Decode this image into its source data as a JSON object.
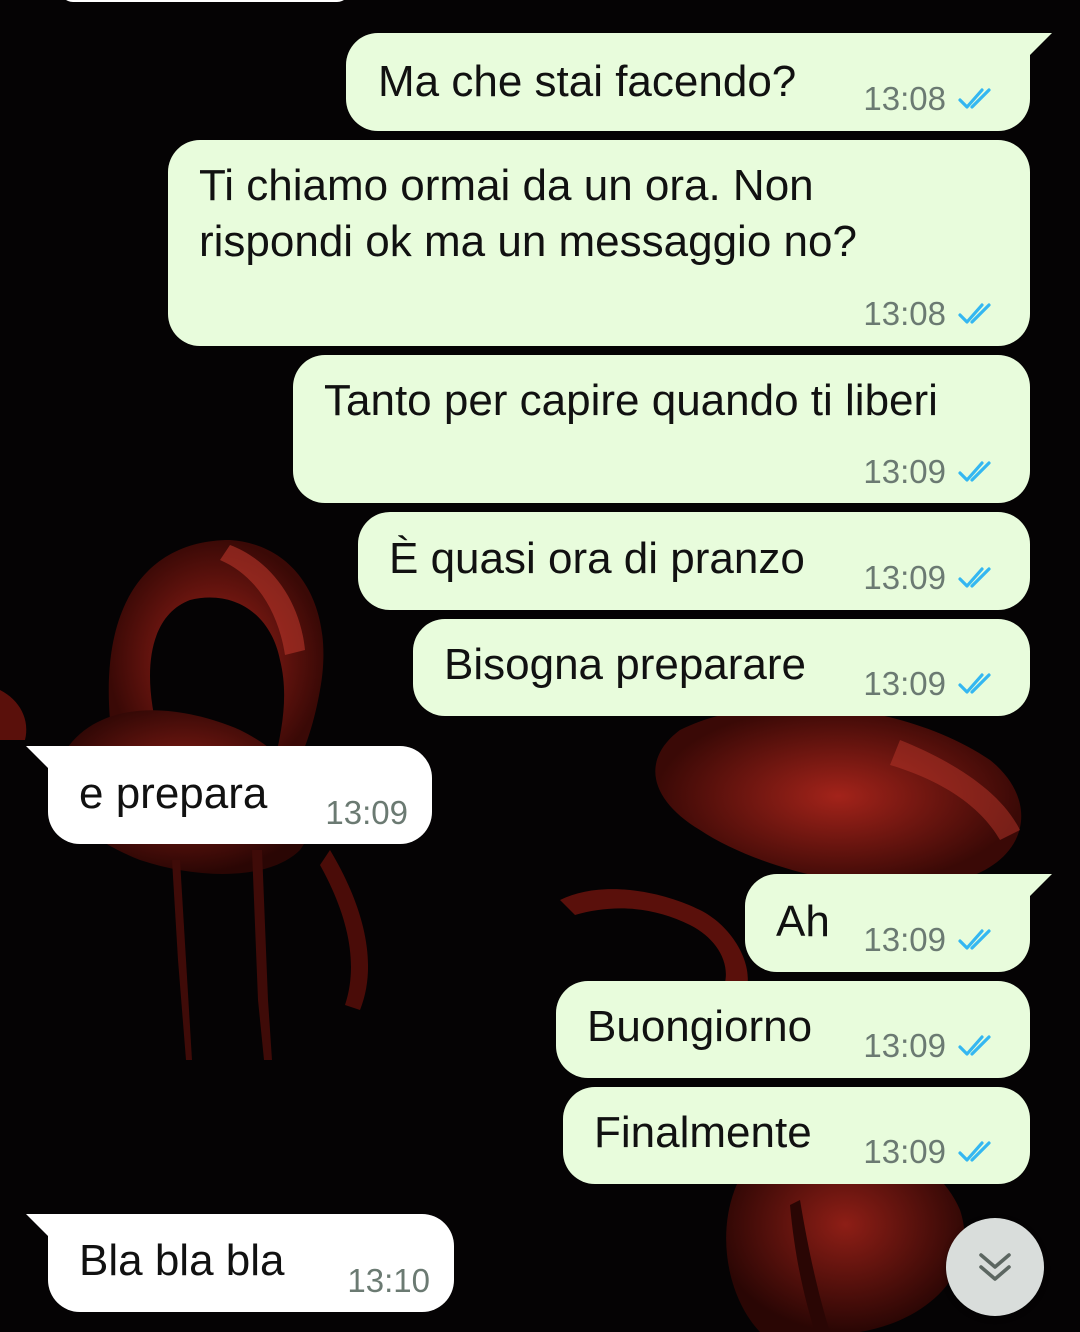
{
  "colors": {
    "outgoing_bubble": "#e8fcdc",
    "incoming_bubble": "#ffffff",
    "read_ticks": "#34b7f1",
    "timestamp": "#6b7a72",
    "background": "#050304"
  },
  "icons": {
    "read_receipt": "double-check-icon",
    "scroll_down": "chevron-double-down-icon"
  },
  "messages": [
    {
      "direction": "outgoing",
      "text": "Ma che stai facendo?",
      "time": "13:08",
      "status": "read"
    },
    {
      "direction": "outgoing",
      "text": "Ti chiamo ormai da un ora. Non\nrispondi ok ma un messaggio no?",
      "time": "13:08",
      "status": "read"
    },
    {
      "direction": "outgoing",
      "text": "Tanto per capire quando ti liberi",
      "time": "13:09",
      "status": "read"
    },
    {
      "direction": "outgoing",
      "text": "È quasi ora di pranzo",
      "time": "13:09",
      "status": "read"
    },
    {
      "direction": "outgoing",
      "text": "Bisogna preparare",
      "time": "13:09",
      "status": "read"
    },
    {
      "direction": "incoming",
      "text": "e prepara",
      "time": "13:09"
    },
    {
      "direction": "outgoing",
      "text": "Ah",
      "time": "13:09",
      "status": "read"
    },
    {
      "direction": "outgoing",
      "text": "Buongiorno",
      "time": "13:09",
      "status": "read"
    },
    {
      "direction": "outgoing",
      "text": "Finalmente",
      "time": "13:09",
      "status": "read"
    },
    {
      "direction": "incoming",
      "text": "Bla bla bla",
      "time": "13:10"
    }
  ]
}
